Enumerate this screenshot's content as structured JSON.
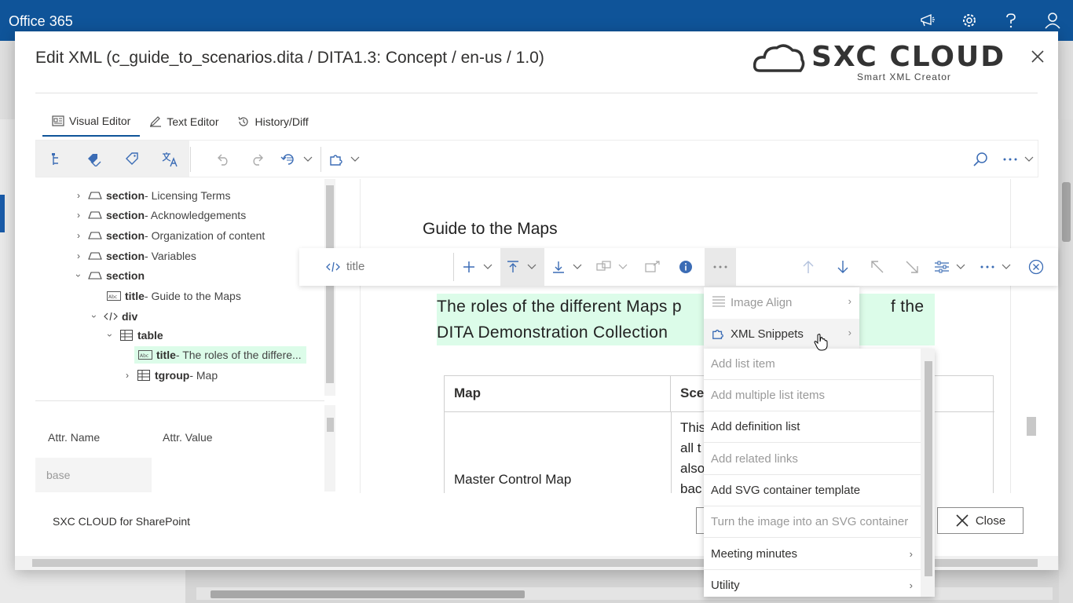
{
  "o365": {
    "title": "Office 365"
  },
  "dialog": {
    "title": "Edit XML (c_guide_to_scenarios.dita / DITA1.3: Concept / en-us / 1.0)",
    "logo_main": "SXC CLOUD",
    "logo_sub": "Smart XML Creator"
  },
  "tabs": [
    {
      "label": "Visual Editor"
    },
    {
      "label": "Text Editor"
    },
    {
      "label": "History/Diff"
    }
  ],
  "tree": {
    "rows": [
      {
        "tag": "section",
        "desc": " - Licensing Terms"
      },
      {
        "tag": "section",
        "desc": " - Acknowledgements"
      },
      {
        "tag": "section",
        "desc": " - Organization of content"
      },
      {
        "tag": "section",
        "desc": " - Variables"
      },
      {
        "tag": "section",
        "desc": ""
      },
      {
        "tag": "title",
        "desc": " - Guide to the Maps"
      },
      {
        "tag": "div",
        "desc": ""
      },
      {
        "tag": "table",
        "desc": ""
      },
      {
        "tag": "title",
        "desc": " - The roles of the differe..."
      },
      {
        "tag": "tgroup",
        "desc": " - Map"
      }
    ]
  },
  "attributes": {
    "col_name": "Attr. Name",
    "col_value": "Attr. Value",
    "rows": [
      {
        "name": "base",
        "value": ""
      }
    ]
  },
  "editor": {
    "heading": "Guide to the Maps",
    "table_title_line1": "The roles of the different Maps p",
    "table_title_line1b": "f the",
    "table_title_line2": "DITA Demonstration Collection",
    "table_head": [
      "Map",
      "Sce"
    ],
    "row1_map": "Master Control Map",
    "row1_desc": [
      "This",
      "all t",
      "also",
      "bac"
    ]
  },
  "float_toolbar": {
    "element": "title"
  },
  "menu_primary": [
    {
      "label": "Image Align",
      "disabled": true
    },
    {
      "label": "XML Snippets",
      "disabled": false
    }
  ],
  "menu_snippets": [
    {
      "label": "Add list item",
      "disabled": true,
      "submenu": false
    },
    {
      "label": "Add multiple list items",
      "disabled": true,
      "submenu": false
    },
    {
      "label": "Add definition list",
      "disabled": false,
      "submenu": false
    },
    {
      "label": "Add related links",
      "disabled": true,
      "submenu": false
    },
    {
      "label": "Add SVG container template",
      "disabled": false,
      "submenu": false
    },
    {
      "label": "Turn the image into an SVG container",
      "disabled": true,
      "submenu": false
    },
    {
      "label": "Meeting minutes",
      "disabled": false,
      "submenu": true
    },
    {
      "label": "Utility",
      "disabled": false,
      "submenu": true
    }
  ],
  "footer": {
    "app_name": "SXC CLOUD for SharePoint",
    "close_label": "Close"
  },
  "colors": {
    "o365_bar": "#0f5499",
    "selection_green": "#dcfce9",
    "icon_blue": "#3b6cb5"
  }
}
